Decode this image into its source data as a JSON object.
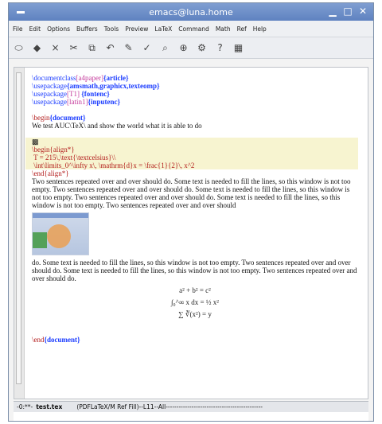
{
  "window": {
    "title": "emacs@luna.home"
  },
  "menubar": {
    "items": [
      "File",
      "Edit",
      "Options",
      "Buffers",
      "Tools",
      "Preview",
      "LaTeX",
      "Command",
      "Math",
      "Ref",
      "Help"
    ]
  },
  "toolbar": {
    "icons": [
      "open-icon",
      "save-icon",
      "close-buffer-icon",
      "cut-icon",
      "copy-icon",
      "undo-icon",
      "paste-icon",
      "spell-icon",
      "search-icon",
      "zoom-icon",
      "preferences-icon",
      "help-icon",
      "latex-preview-icon"
    ]
  },
  "editor": {
    "line1_cmd": "\\documentclass",
    "line1_opt": "[a4paper]",
    "line1_arg": "{article}",
    "line2_cmd": "\\usepackage",
    "line2_arg": "{amsmath,graphicx,texteomp}",
    "line3_cmd": "\\usepackage",
    "line3_opt": "[T1]",
    "line3_arg": " {fontenc}",
    "line4_cmd": "\\usepackage",
    "line4_opt": "[latin1]",
    "line4_arg": "{inputenc}",
    "begin_doc_cmd": "\\begin",
    "begin_doc_arg": "{document}",
    "intro_text": "We test AUC\\TeX\\ and show the world what it is able to do",
    "mark": "▩",
    "begin_align": "\\begin{align*}",
    "align_line1": " T = 215\\,\\text{\\textcelsius}\\\\",
    "align_line2": " \\int\\limits_0^\\infty x\\, \\mathrm{d}x = \\frac{1}{2}\\, x^2",
    "end_align": "\\end{align*}",
    "para1": "Two sentences repeated over and over should do.  Some text is needed to fill the lines, so this window is not too empty.  Two sentences repeated over and over should do. Some text is needed to fill the lines, so this window is not too empty.  Two sentences repeated over and over should do.  Some text is needed to fill the lines, so this window is not too empty.  Two sentences repeated over and over should",
    "para2": "do.  Some text is needed to fill the lines, so this window is not too empty.  Two sentences repeated over and over should do.  Some text is needed to fill the lines, so this window is not too empty.  Two sentences repeated over and over should do.",
    "math1": "a² + b² = c²",
    "math2": "∫₀^∞ x dx = ½ x²",
    "math3": "∑ ∛(x²) = y",
    "end_doc_cmd": "\\end",
    "end_doc_arg": "{document}"
  },
  "status": {
    "flags": "-0:**-",
    "filename": "test.tex",
    "mode": "(PDFLaTeX/M Ref Fill)--L11--All---------------------------------------------"
  }
}
